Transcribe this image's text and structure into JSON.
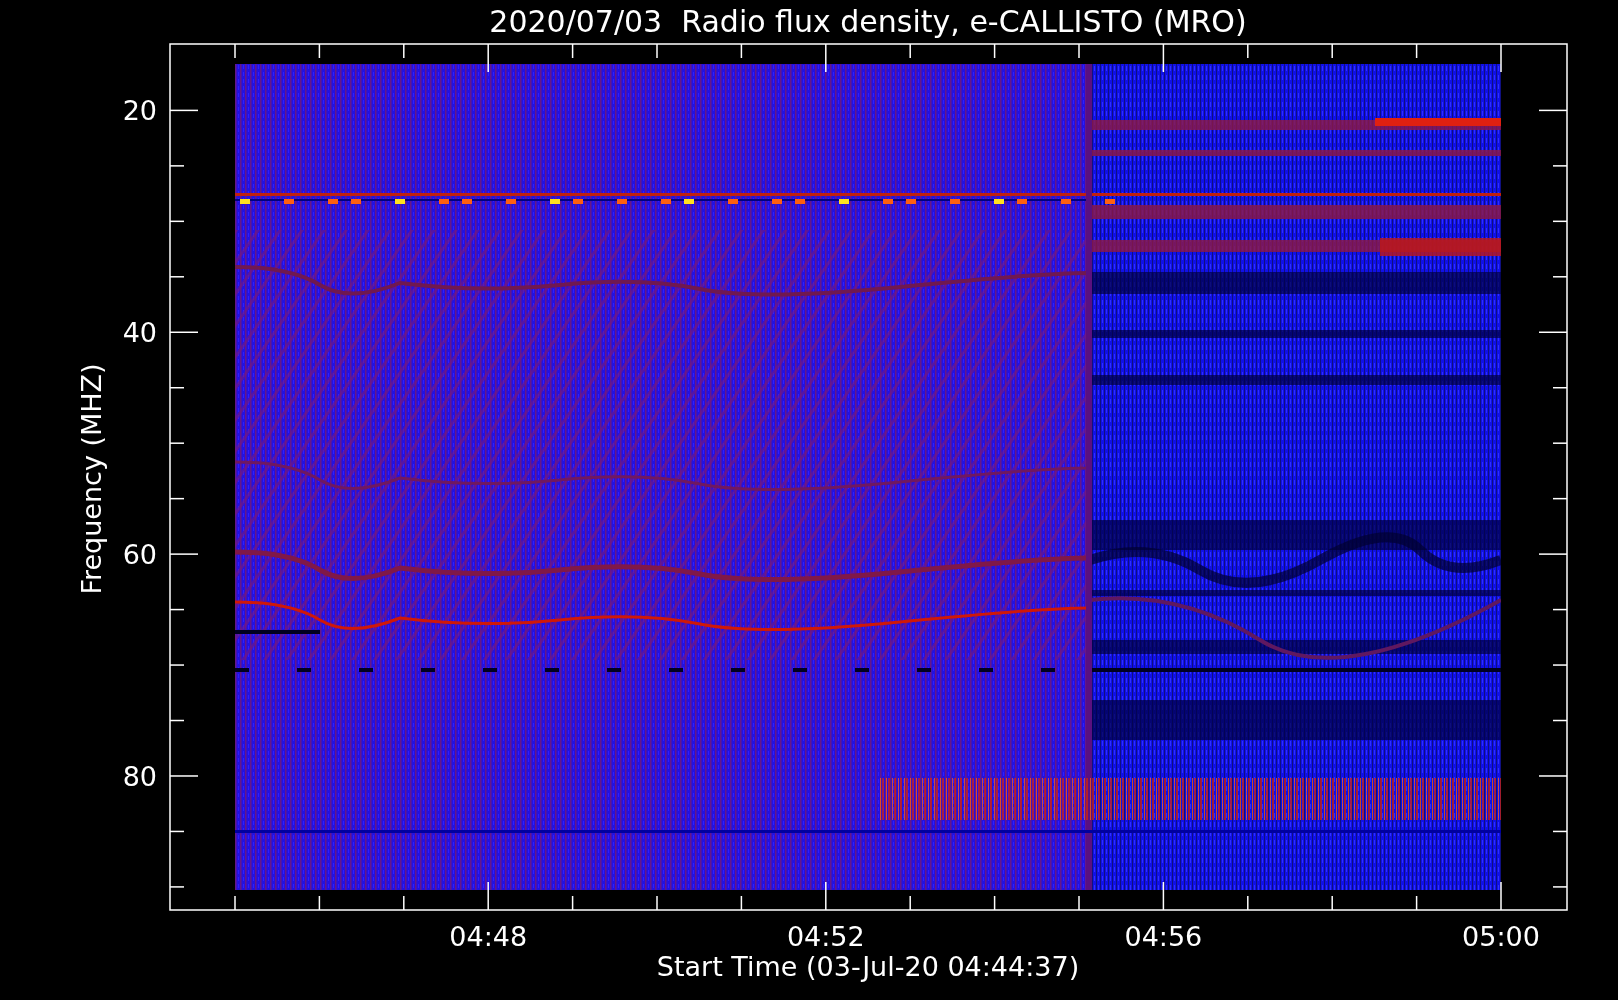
{
  "title": "2020/07/03  Radio flux density, e-CALLISTO (MRO)",
  "y_axis": {
    "label": "Frequency (MHZ)",
    "ticks": [
      "20",
      "40",
      "60",
      "80"
    ]
  },
  "x_axis": {
    "label": "Start Time (03-Jul-20 04:44:37)",
    "ticks": [
      "04:48",
      "04:52",
      "04:56",
      "05:00"
    ]
  }
}
